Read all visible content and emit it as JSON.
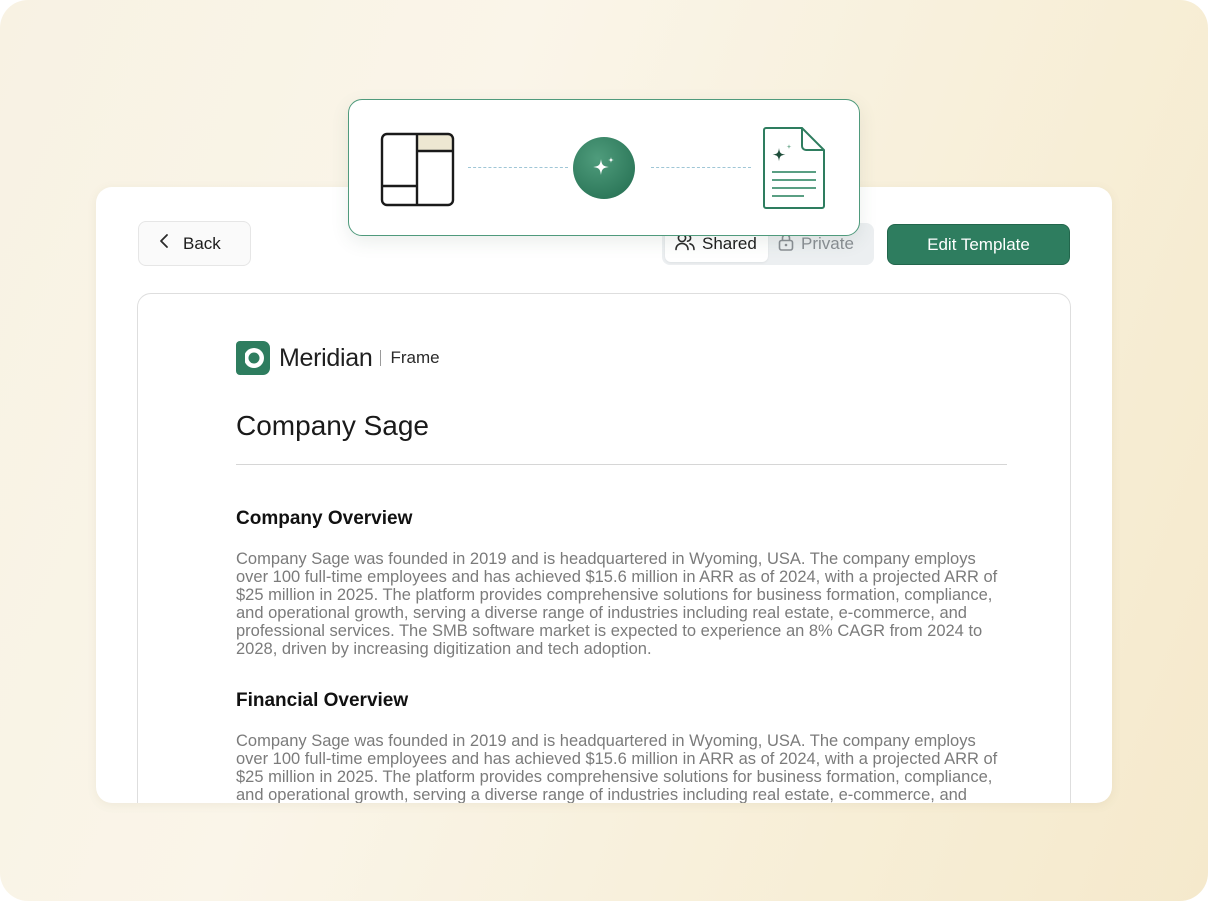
{
  "toolbar": {
    "back_label": "Back",
    "shared_label": "Shared",
    "private_label": "Private",
    "edit_label": "Edit Template"
  },
  "document": {
    "brand": "Meridian",
    "product": "Frame",
    "title": "Company Sage",
    "sections": [
      {
        "heading": "Company Overview",
        "body": "Company Sage was founded in 2019 and is headquartered in Wyoming, USA. The company employs over 100 full-time employees and has achieved $15.6 million in ARR as of 2024, with a projected ARR of $25 million in 2025. The platform provides comprehensive solutions for business formation, compliance, and operational growth, serving a diverse range of industries including real estate, e-commerce, and professional services. The SMB software market is expected to experience an 8% CAGR from 2024 to 2028, driven by increasing digitization and tech adoption."
      },
      {
        "heading": "Financial Overview",
        "body": "Company Sage was founded in 2019 and is headquartered in Wyoming, USA. The company employs over 100 full-time employees and has achieved $15.6 million in ARR as of 2024, with a projected ARR of $25 million in 2025. The platform provides comprehensive solutions for business formation, compliance, and operational growth, serving a diverse range of industries including real estate, e-commerce, and professional services."
      }
    ]
  },
  "icons": {
    "back": "chevron-left-icon",
    "shared": "users-icon",
    "private": "lock-icon",
    "template": "layout-template-icon",
    "ai": "sparkles-icon",
    "output": "generated-document-icon"
  },
  "colors": {
    "accent": "#2e7d5f",
    "toggle_bg": "#eceff1",
    "body_text": "#7b7b7b",
    "background": "#f8f2e3"
  }
}
